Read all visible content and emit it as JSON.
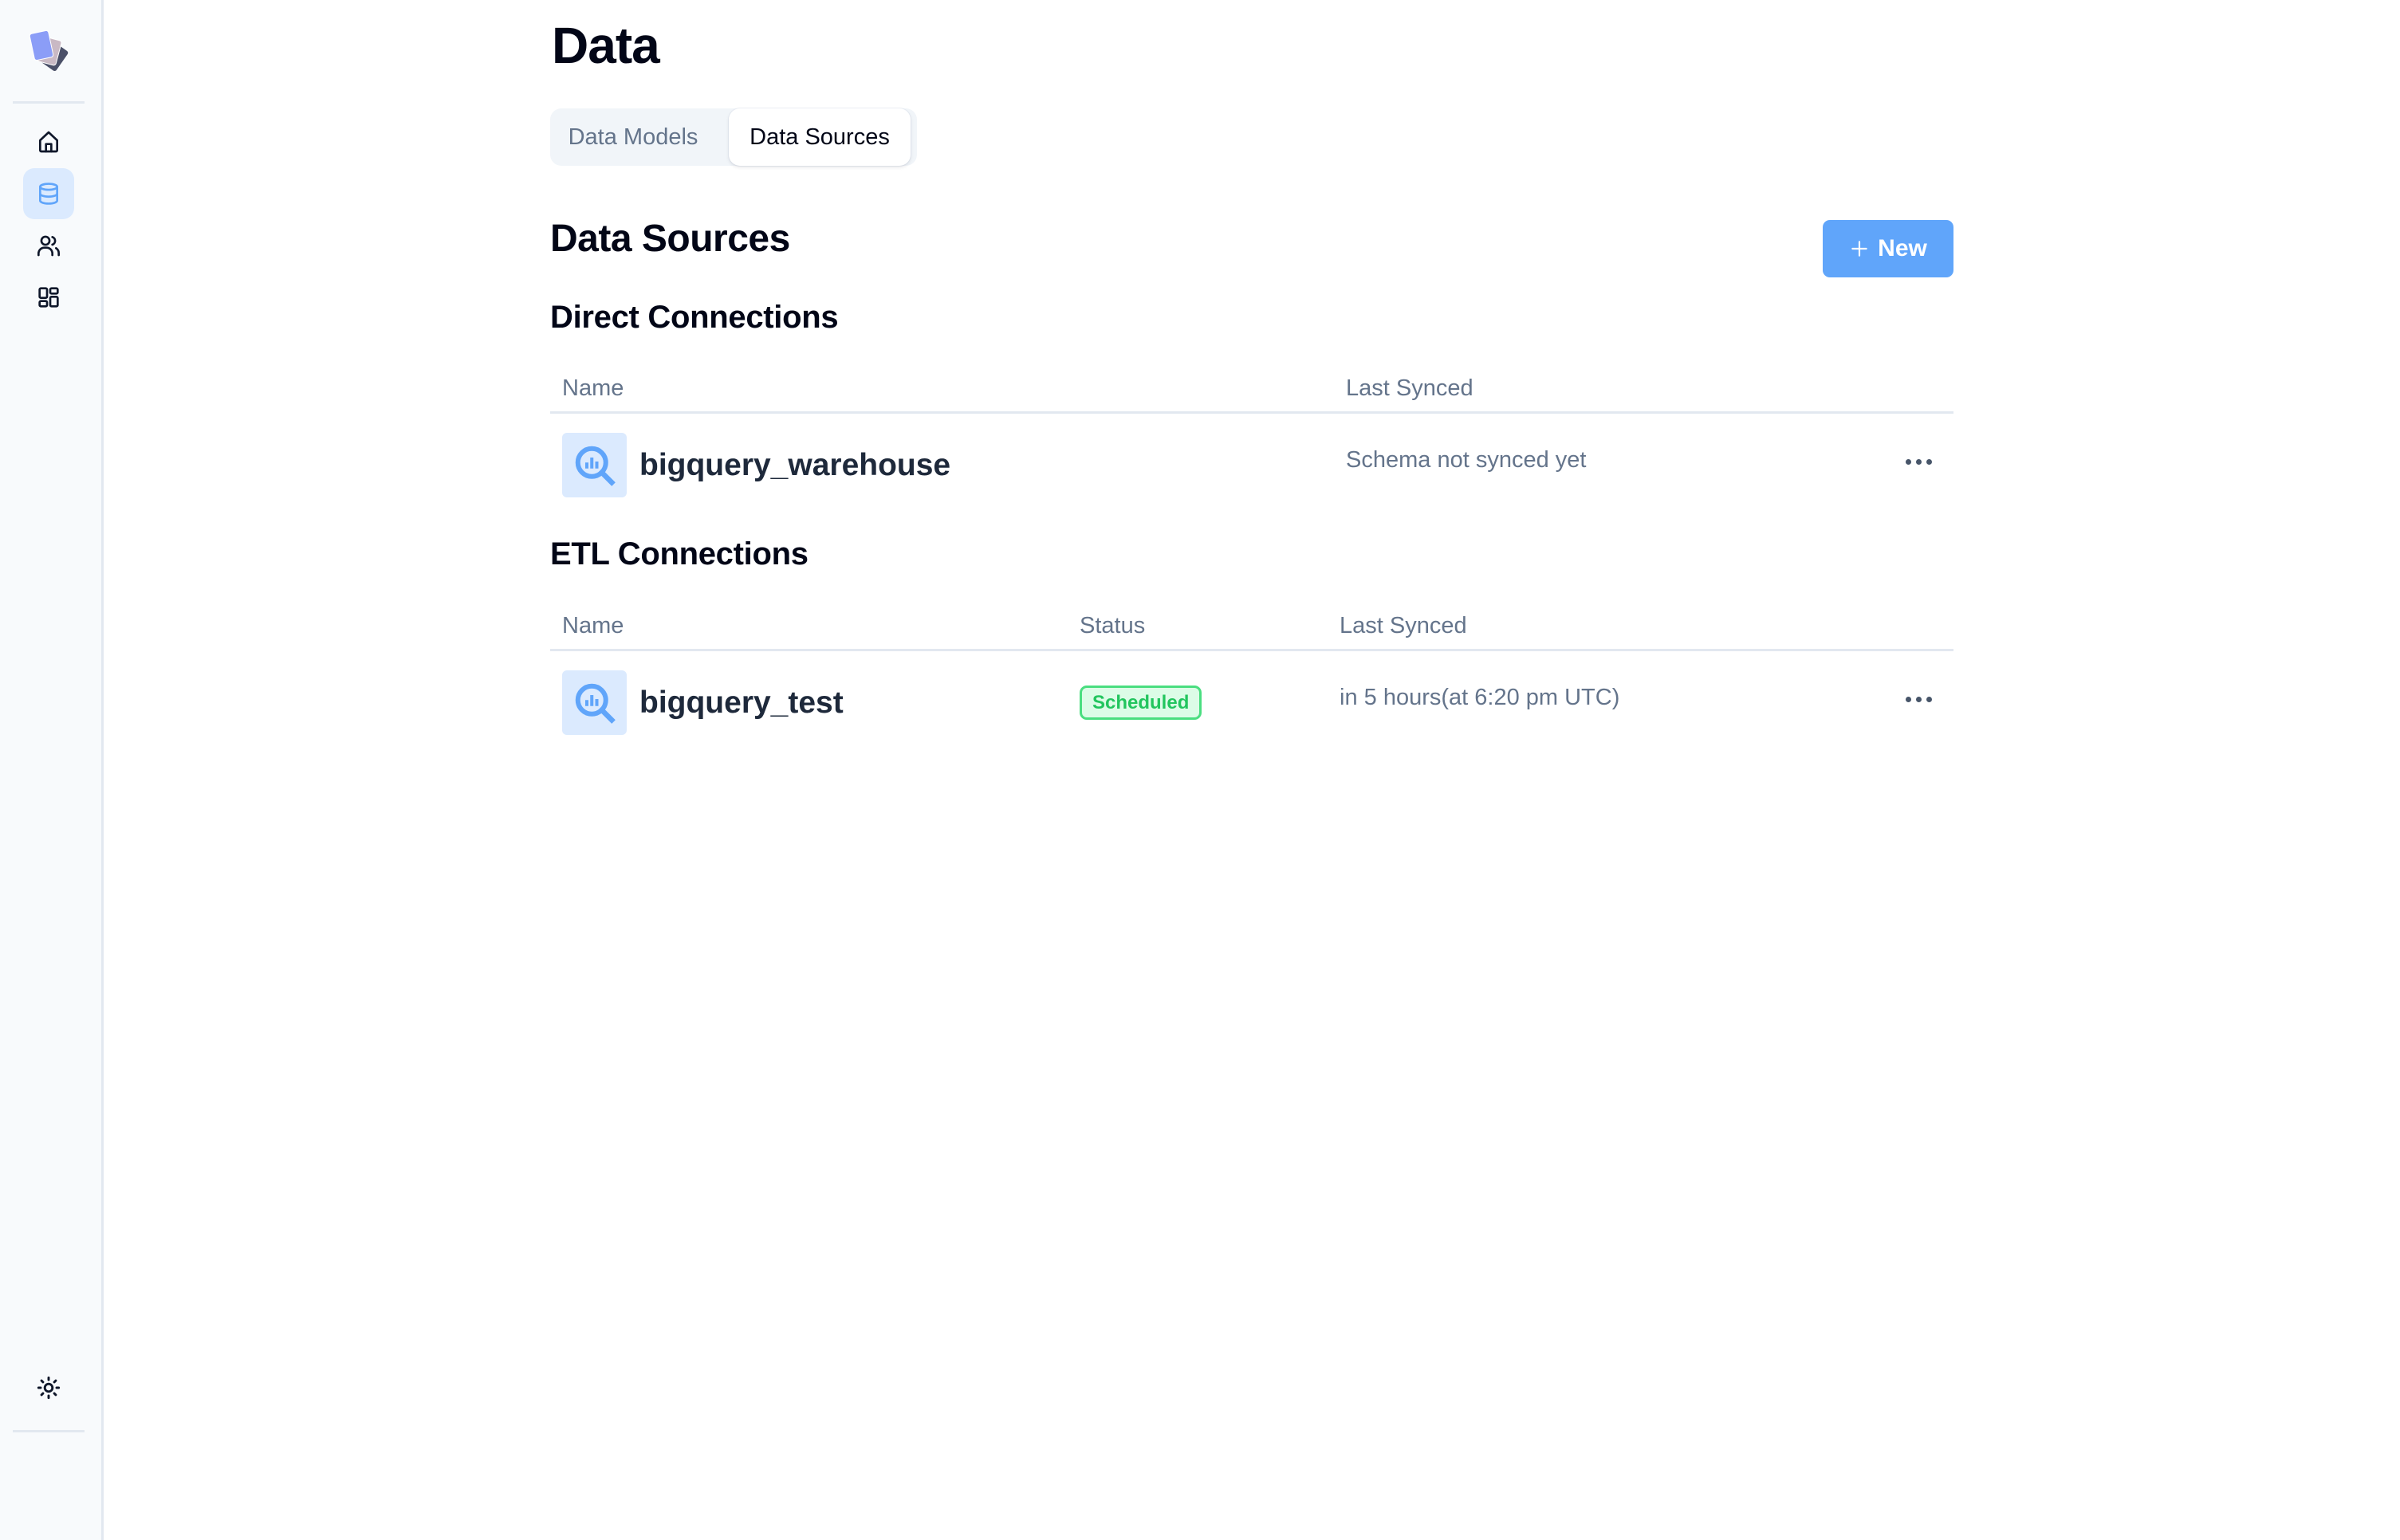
{
  "sidebar": {
    "logo": "app-logo",
    "items": [
      {
        "id": "home",
        "icon": "home-icon",
        "active": false
      },
      {
        "id": "data",
        "icon": "database-icon",
        "active": true
      },
      {
        "id": "users",
        "icon": "users-icon",
        "active": false
      },
      {
        "id": "dashboards",
        "icon": "grid-icon",
        "active": false
      }
    ],
    "bottom_items": [
      {
        "id": "theme-toggle",
        "icon": "sun-icon"
      }
    ]
  },
  "page": {
    "title": "Data",
    "tabs": [
      {
        "label": "Data Models",
        "active": false
      },
      {
        "label": "Data Sources",
        "active": true
      }
    ]
  },
  "data_sources": {
    "title": "Data Sources",
    "new_button": {
      "label": "New",
      "icon": "plus-icon"
    },
    "direct_connections": {
      "title": "Direct Connections",
      "columns": [
        "Name",
        "Last Synced"
      ],
      "rows": [
        {
          "name": "bigquery_warehouse",
          "icon": "bigquery-icon",
          "last_synced": "Schema not synced yet",
          "actions_icon": "more-horizontal-icon"
        }
      ]
    },
    "etl_connections": {
      "title": "ETL Connections",
      "columns": [
        "Name",
        "Status",
        "Last Synced"
      ],
      "rows": [
        {
          "name": "bigquery_test",
          "icon": "bigquery-icon",
          "status": "Scheduled",
          "last_synced": "in 5 hours(at 6:20 pm UTC)",
          "actions_icon": "more-horizontal-icon"
        }
      ]
    }
  },
  "colors": {
    "accent": "#60a5fa",
    "accent_light": "#dbeafe",
    "status_scheduled_text": "#22c55e",
    "status_scheduled_bg": "#dcfce7",
    "status_scheduled_border": "#4ade80",
    "muted_text": "#64748b"
  }
}
